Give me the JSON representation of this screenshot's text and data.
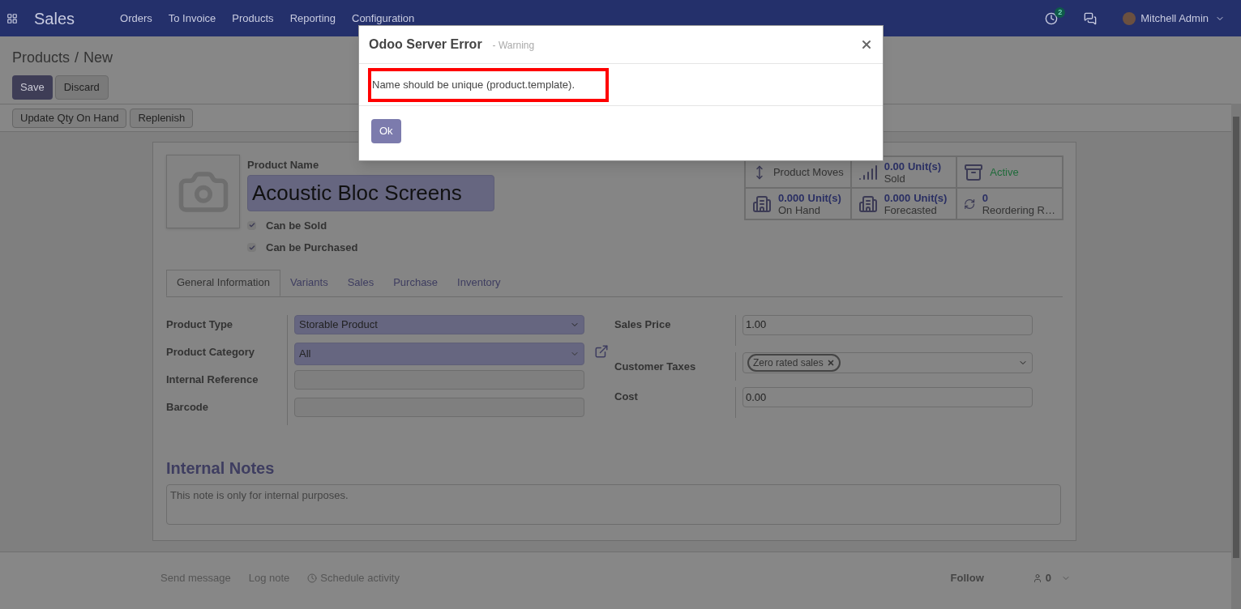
{
  "navbar": {
    "app": "Sales",
    "menu": [
      "Orders",
      "To Invoice",
      "Products",
      "Reporting",
      "Configuration"
    ],
    "activity_count": "2",
    "user": "Mitchell Admin"
  },
  "breadcrumb": {
    "parent": "Products",
    "separator": "/",
    "current": "New"
  },
  "actions": [
    "Save",
    "Discard"
  ],
  "header_buttons": [
    "Update Qty On Hand",
    "Replenish"
  ],
  "stat_buttons": [
    {
      "kind": "moves",
      "label": "Product Moves"
    },
    {
      "kind": "sold",
      "value": "0.00",
      "unit": "Unit(s)",
      "label": "Sold"
    },
    {
      "kind": "active",
      "label": "Active"
    },
    {
      "kind": "onhand",
      "value": "0.000",
      "unit": "Unit(s)",
      "label": "On Hand"
    },
    {
      "kind": "forecast",
      "value": "0.000",
      "unit": "Unit(s)",
      "label": "Forecasted"
    },
    {
      "kind": "reorder",
      "value": "0",
      "label": "Reordering R…"
    }
  ],
  "product": {
    "name_label": "Product Name",
    "name": "Acoustic Bloc Screens",
    "checks": [
      {
        "label": "Can be Sold",
        "checked": true
      },
      {
        "label": "Can be Purchased",
        "checked": true
      }
    ]
  },
  "tabs": [
    {
      "label": "General Information",
      "selected": true
    },
    {
      "label": "Variants",
      "selected": false
    },
    {
      "label": "Sales",
      "selected": false
    },
    {
      "label": "Purchase",
      "selected": false
    },
    {
      "label": "Inventory",
      "selected": false
    }
  ],
  "left_fields": [
    {
      "kind": "select",
      "label": "Product Type",
      "value": "Storable Product",
      "required": true
    },
    {
      "kind": "many2one",
      "label": "Product Category",
      "value": "All",
      "required": true
    },
    {
      "kind": "text",
      "label": "Internal Reference",
      "required": false
    },
    {
      "kind": "text",
      "label": "Barcode",
      "required": false
    }
  ],
  "right_fields": [
    {
      "kind": "text",
      "label": "Sales Price",
      "value": "1.00"
    },
    {
      "kind": "tags",
      "label": "Customer Taxes",
      "tags": [
        "Zero rated sales"
      ]
    },
    {
      "kind": "text",
      "label": "Cost",
      "value": "0.00"
    }
  ],
  "notes": {
    "title": "Internal Notes",
    "placeholder": "This note is only for internal purposes."
  },
  "chatter": {
    "links": [
      "Send message",
      "Log note",
      "Schedule activity"
    ],
    "follow": "Follow",
    "followers": "0"
  },
  "dialog": {
    "title": "Odoo Server Error",
    "subtitle": "- Warning",
    "message": "Name should be unique (product.template).",
    "button": "Ok"
  }
}
